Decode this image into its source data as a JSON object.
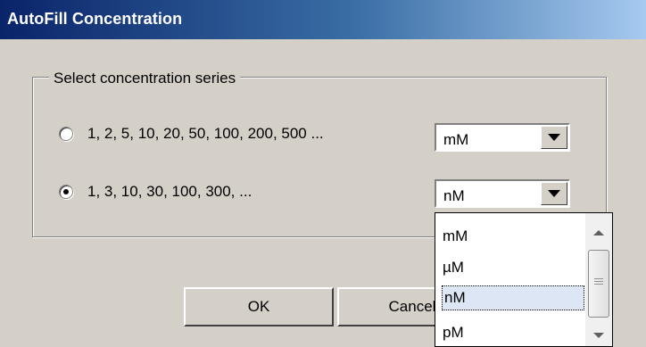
{
  "window": {
    "title": "AutoFill Concentration"
  },
  "group": {
    "legend": "Select concentration series"
  },
  "options": [
    {
      "label": "1, 2, 5, 10, 20, 50, 100, 200, 500 ...",
      "selected": false,
      "unit": "mM"
    },
    {
      "label": "1, 3, 10, 30, 100, 300, ...",
      "selected": true,
      "unit": "nM"
    }
  ],
  "dropdown": {
    "items": [
      "mM",
      "µM",
      "nM",
      "pM"
    ],
    "highlighted_index": 2
  },
  "buttons": {
    "ok": "OK",
    "cancel": "Cancel"
  },
  "colors": {
    "title_start": "#0a246a",
    "title_end": "#a6caf0",
    "dialog_bg": "#d4d0c8"
  }
}
